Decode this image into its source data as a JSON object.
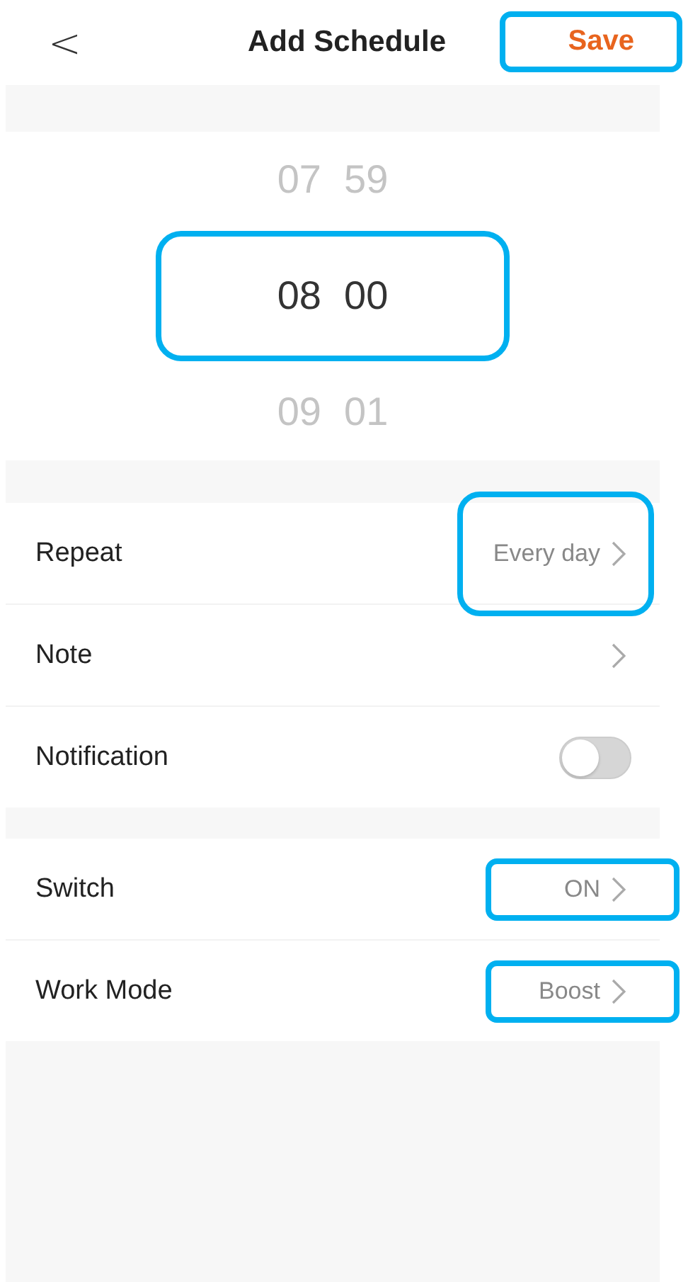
{
  "header": {
    "back": "<",
    "title": "Add Schedule",
    "save": {
      "label": "Save",
      "highlighted": true
    }
  },
  "picker": {
    "rows": [
      {
        "hour": "07",
        "minute": "59",
        "selected": false,
        "highlighted": false
      },
      {
        "hour": "08",
        "minute": "00",
        "selected": true,
        "highlighted": true
      },
      {
        "hour": "09",
        "minute": "01",
        "selected": false,
        "highlighted": false
      }
    ]
  },
  "groups": [
    {
      "rows": [
        {
          "kind": "link",
          "label": "Repeat",
          "value": "Every day",
          "highlighted": true
        },
        {
          "kind": "link",
          "label": "Note",
          "highlighted": false
        },
        {
          "kind": "toggle",
          "label": "Notification",
          "on": false
        }
      ]
    },
    {
      "rows": [
        {
          "kind": "link",
          "label": "Switch",
          "value": "ON",
          "highlighted": true
        },
        {
          "kind": "link",
          "label": "Work Mode",
          "value": "Boost",
          "highlighted": true
        }
      ]
    }
  ]
}
